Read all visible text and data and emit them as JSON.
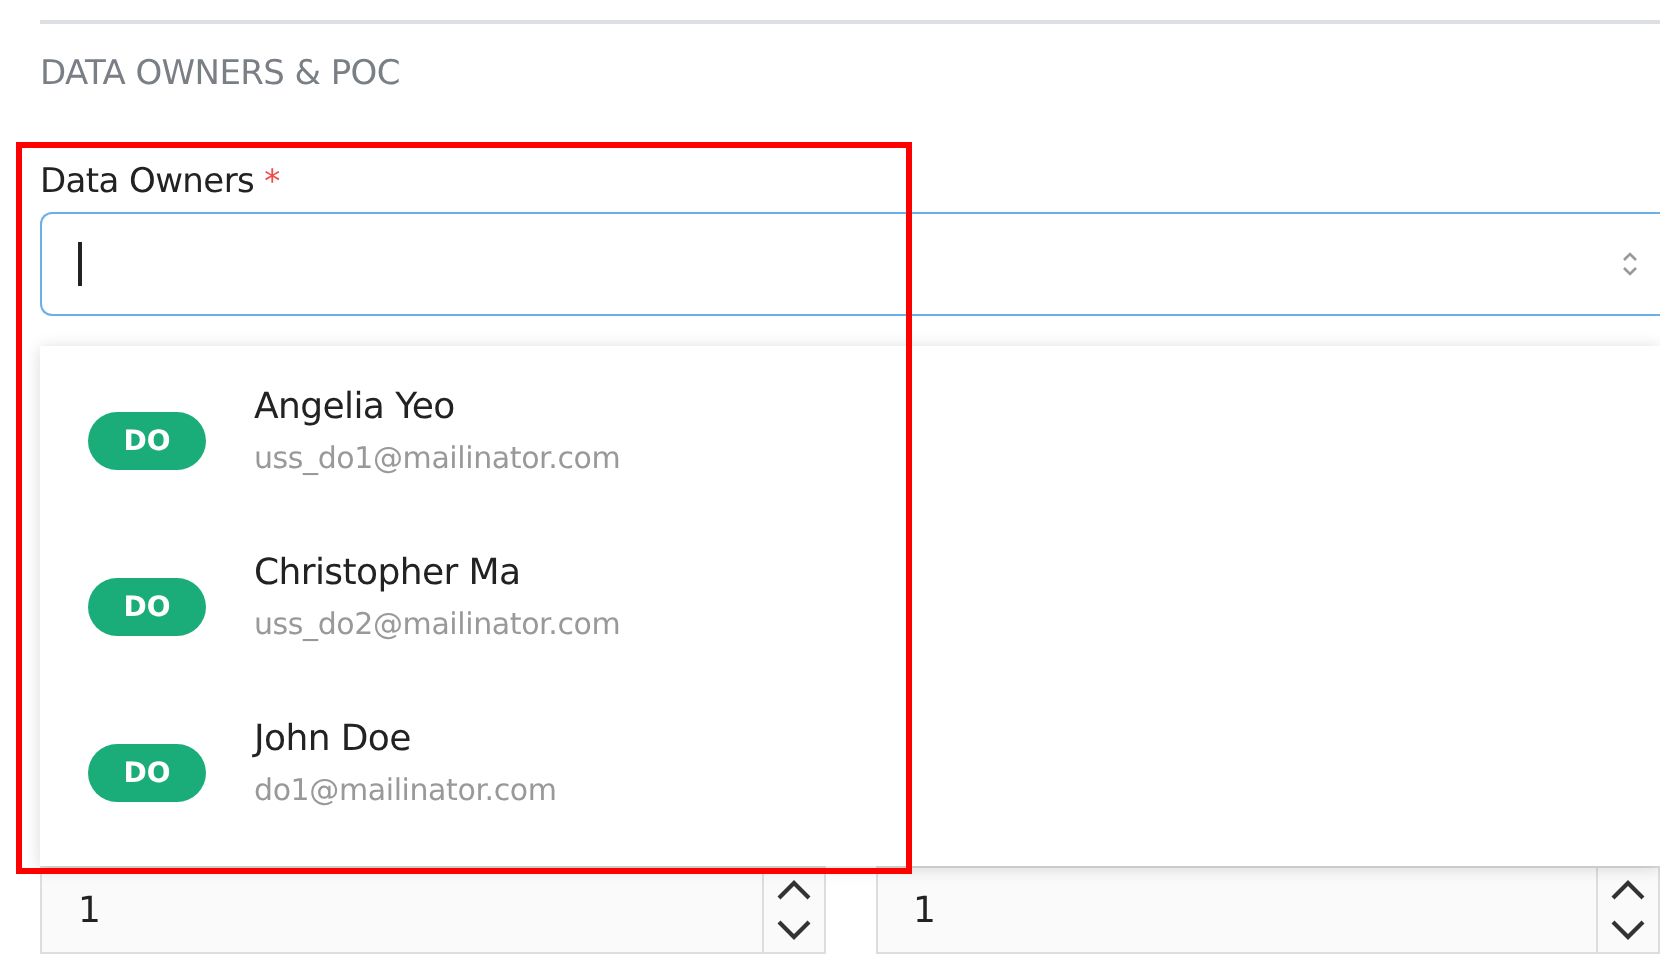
{
  "section": {
    "title": "DATA OWNERS & POC"
  },
  "field": {
    "label": "Data Owners",
    "required": true,
    "required_mark": "*",
    "focused": true
  },
  "options": [
    {
      "badge": "DO",
      "name": "Angelia Yeo",
      "email": "uss_do1@mailinator.com"
    },
    {
      "badge": "DO",
      "name": "Christopher Ma",
      "email": "uss_do2@mailinator.com"
    },
    {
      "badge": "DO",
      "name": "John Doe",
      "email": "do1@mailinator.com"
    }
  ],
  "number_fields": [
    {
      "value": "1"
    },
    {
      "value": "1"
    }
  ]
}
